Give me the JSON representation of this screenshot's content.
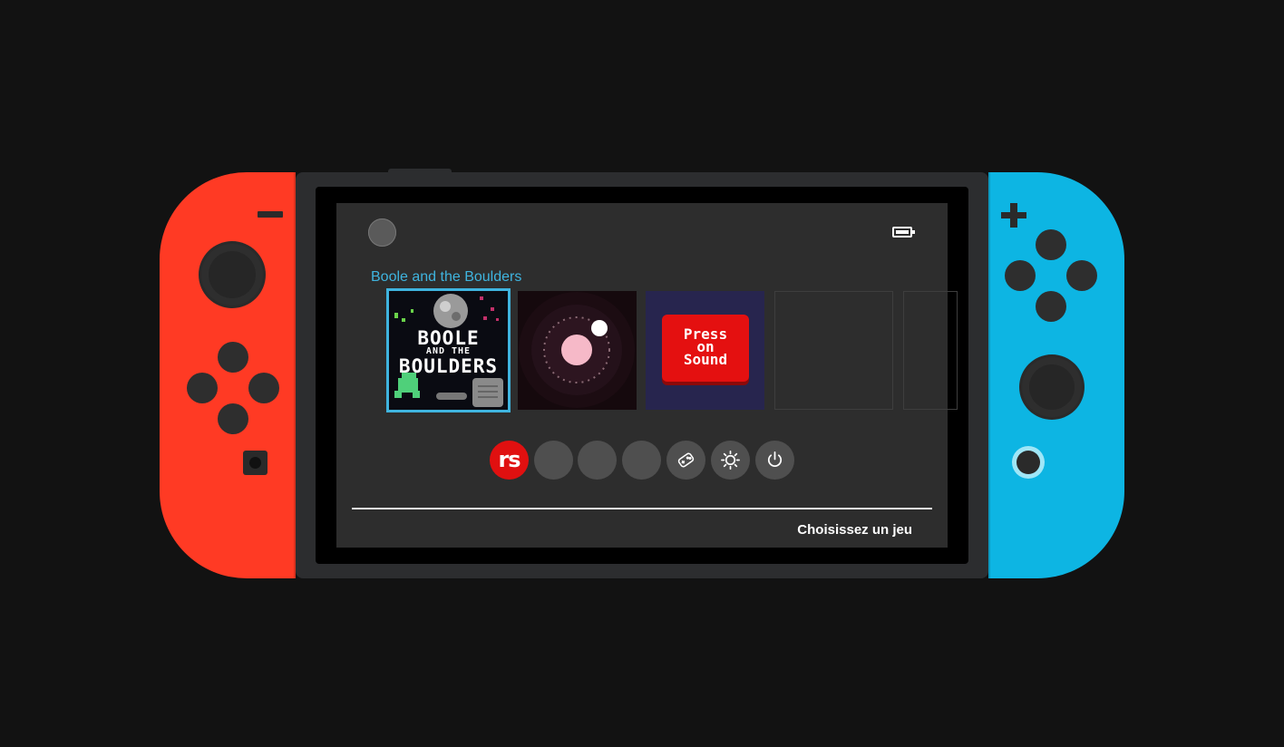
{
  "console": {
    "left_joycon_color": "#ff3a24",
    "right_joycon_color": "#0db5e3",
    "body_color": "#2c2d2f"
  },
  "screen": {
    "selected_game_title": "Boole and the Boulders",
    "games": [
      {
        "name": "Boole and the Boulders",
        "art_line1": "BOOLE",
        "art_line2": "AND THE",
        "art_line3": "BOULDERS",
        "selected": true
      },
      {
        "name": "orbit-game",
        "selected": false
      },
      {
        "name": "Press on Sound",
        "art_line1": "Press",
        "art_line2": "on",
        "art_line3": "Sound",
        "selected": false
      },
      {
        "name": "empty-slot",
        "selected": false
      },
      {
        "name": "empty-slot",
        "selected": false
      }
    ],
    "dock": [
      {
        "id": "rs",
        "label": "rs"
      },
      {
        "id": "blank1",
        "label": ""
      },
      {
        "id": "blank2",
        "label": ""
      },
      {
        "id": "blank3",
        "label": ""
      },
      {
        "id": "controllers",
        "icon": "controller-icon"
      },
      {
        "id": "settings",
        "icon": "settings-icon"
      },
      {
        "id": "power",
        "icon": "power-icon"
      }
    ],
    "footer_hint": "Choisissez un jeu",
    "accent_color": "#3fb4df"
  }
}
